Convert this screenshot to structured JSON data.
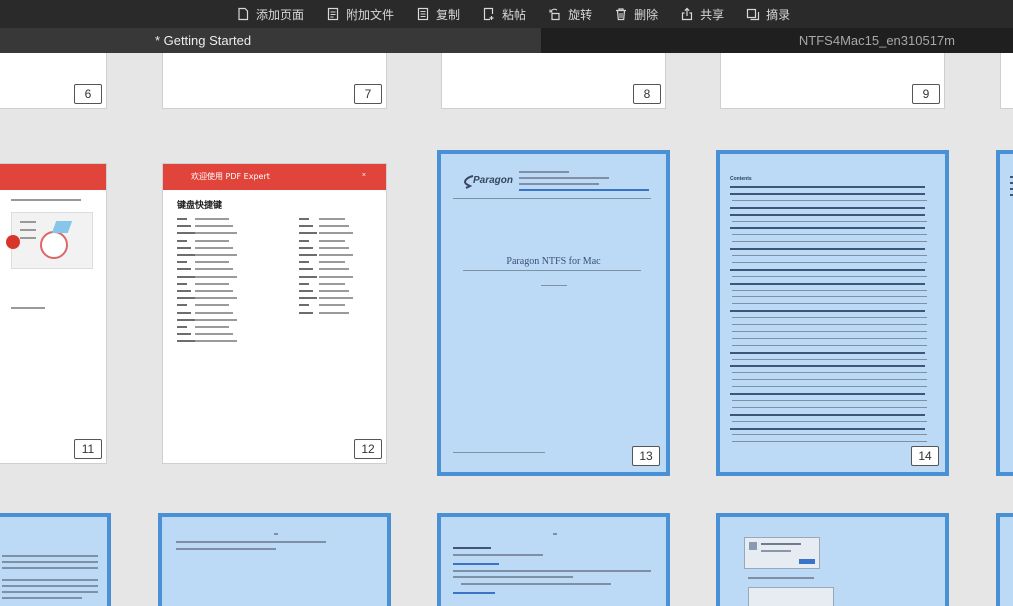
{
  "toolbar": {
    "items": [
      {
        "label": "添加页面",
        "icon": "add-page-icon"
      },
      {
        "label": "附加文件",
        "icon": "attach-file-icon"
      },
      {
        "label": "复制",
        "icon": "copy-icon"
      },
      {
        "label": "粘帖",
        "icon": "paste-icon"
      },
      {
        "label": "旋转",
        "icon": "rotate-icon"
      },
      {
        "label": "删除",
        "icon": "trash-icon"
      },
      {
        "label": "共享",
        "icon": "share-icon"
      },
      {
        "label": "摘录",
        "icon": "extract-icon"
      }
    ]
  },
  "tabs": {
    "active": "* Getting Started",
    "inactive": "NTFS4Mac15_en310517m"
  },
  "colors": {
    "selection_border": "#4a90d4",
    "selection_fill": "#bcd9f5",
    "header_red": "#e0443a"
  },
  "pages": {
    "p6": "6",
    "p7": "7",
    "p8": "8",
    "p9": "9",
    "p11": "11",
    "p12": "12",
    "p13": "13",
    "p14": "14"
  },
  "page12": {
    "header": "欢迎使用  PDF Expert",
    "close": "×",
    "heading": "键盘快捷键"
  },
  "page13": {
    "logo": "Paragon",
    "title": "Paragon NTFS for Mac"
  },
  "page14": {
    "heading": "Contents"
  }
}
